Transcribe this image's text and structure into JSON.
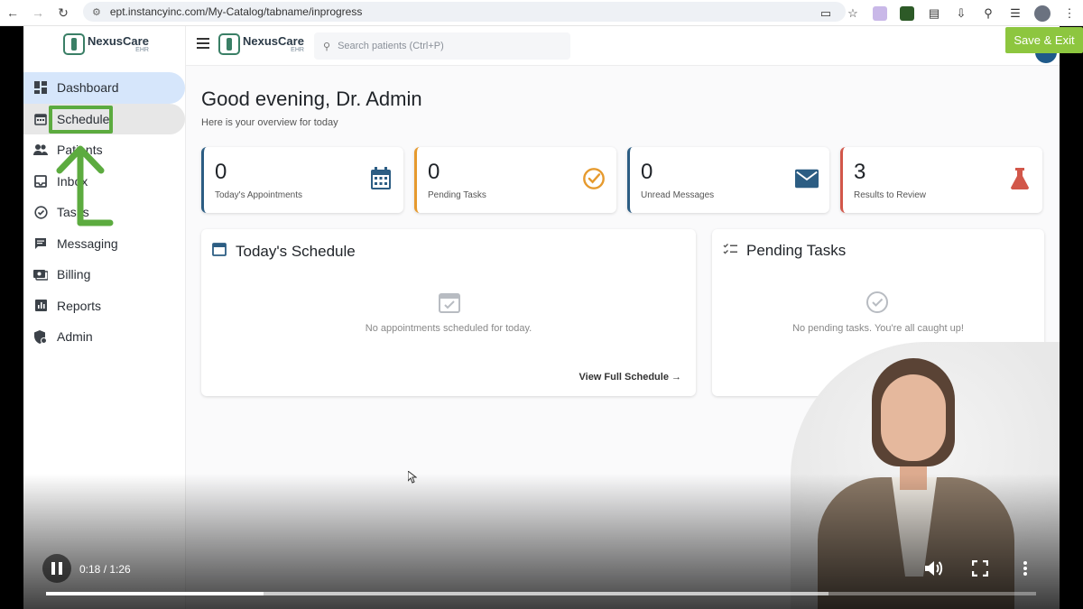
{
  "browser": {
    "url": "ept.instancyinc.com/My-Catalog/tabname/inprogress",
    "nav_icons": [
      "back-icon",
      "forward-icon",
      "reload-icon"
    ],
    "toolbar_icons": [
      "install-app-icon",
      "bookmark-star-icon",
      "extension-icon",
      "extension-icon",
      "extensions-puzzle-icon",
      "download-icon",
      "lens-icon",
      "media-icon",
      "profile-icon",
      "more-vert-icon"
    ]
  },
  "overlay": {
    "save_exit": "Save & Exit"
  },
  "app": {
    "logo_name": "NexusCare",
    "logo_sub": "EHR",
    "search_placeholder": "Search patients (Ctrl+P)"
  },
  "sidebar": {
    "items": [
      {
        "label": "Dashboard",
        "icon": "dashboard-icon"
      },
      {
        "label": "Schedule",
        "icon": "calendar-icon"
      },
      {
        "label": "Patients",
        "icon": "people-icon"
      },
      {
        "label": "Inbox",
        "icon": "inbox-icon"
      },
      {
        "label": "Tasks",
        "icon": "check-circle-icon"
      },
      {
        "label": "Messaging",
        "icon": "message-icon"
      },
      {
        "label": "Billing",
        "icon": "billing-icon"
      },
      {
        "label": "Reports",
        "icon": "reports-icon"
      },
      {
        "label": "Admin",
        "icon": "admin-shield-icon"
      }
    ]
  },
  "main": {
    "greeting": "Good evening, Dr. Admin",
    "subtitle": "Here is your overview for today",
    "stats": [
      {
        "value": "0",
        "label": "Today's Appointments",
        "icon": "calendar-icon",
        "color": "#2c5d83"
      },
      {
        "value": "0",
        "label": "Pending Tasks",
        "icon": "check-circle-icon",
        "color": "#e69a2e"
      },
      {
        "value": "0",
        "label": "Unread Messages",
        "icon": "mail-icon",
        "color": "#2c5d83"
      },
      {
        "value": "3",
        "label": "Results to Review",
        "icon": "flask-icon",
        "color": "#d2574a"
      }
    ],
    "schedule_card": {
      "title": "Today's Schedule",
      "empty_text": "No appointments scheduled for today.",
      "link": "View Full Schedule →"
    },
    "tasks_card": {
      "title": "Pending Tasks",
      "empty_text": "No pending tasks. You're all caught up!"
    }
  },
  "video": {
    "time": "0:18 / 1:26",
    "played_fraction": 0.22,
    "buffered_fraction": 0.79
  }
}
